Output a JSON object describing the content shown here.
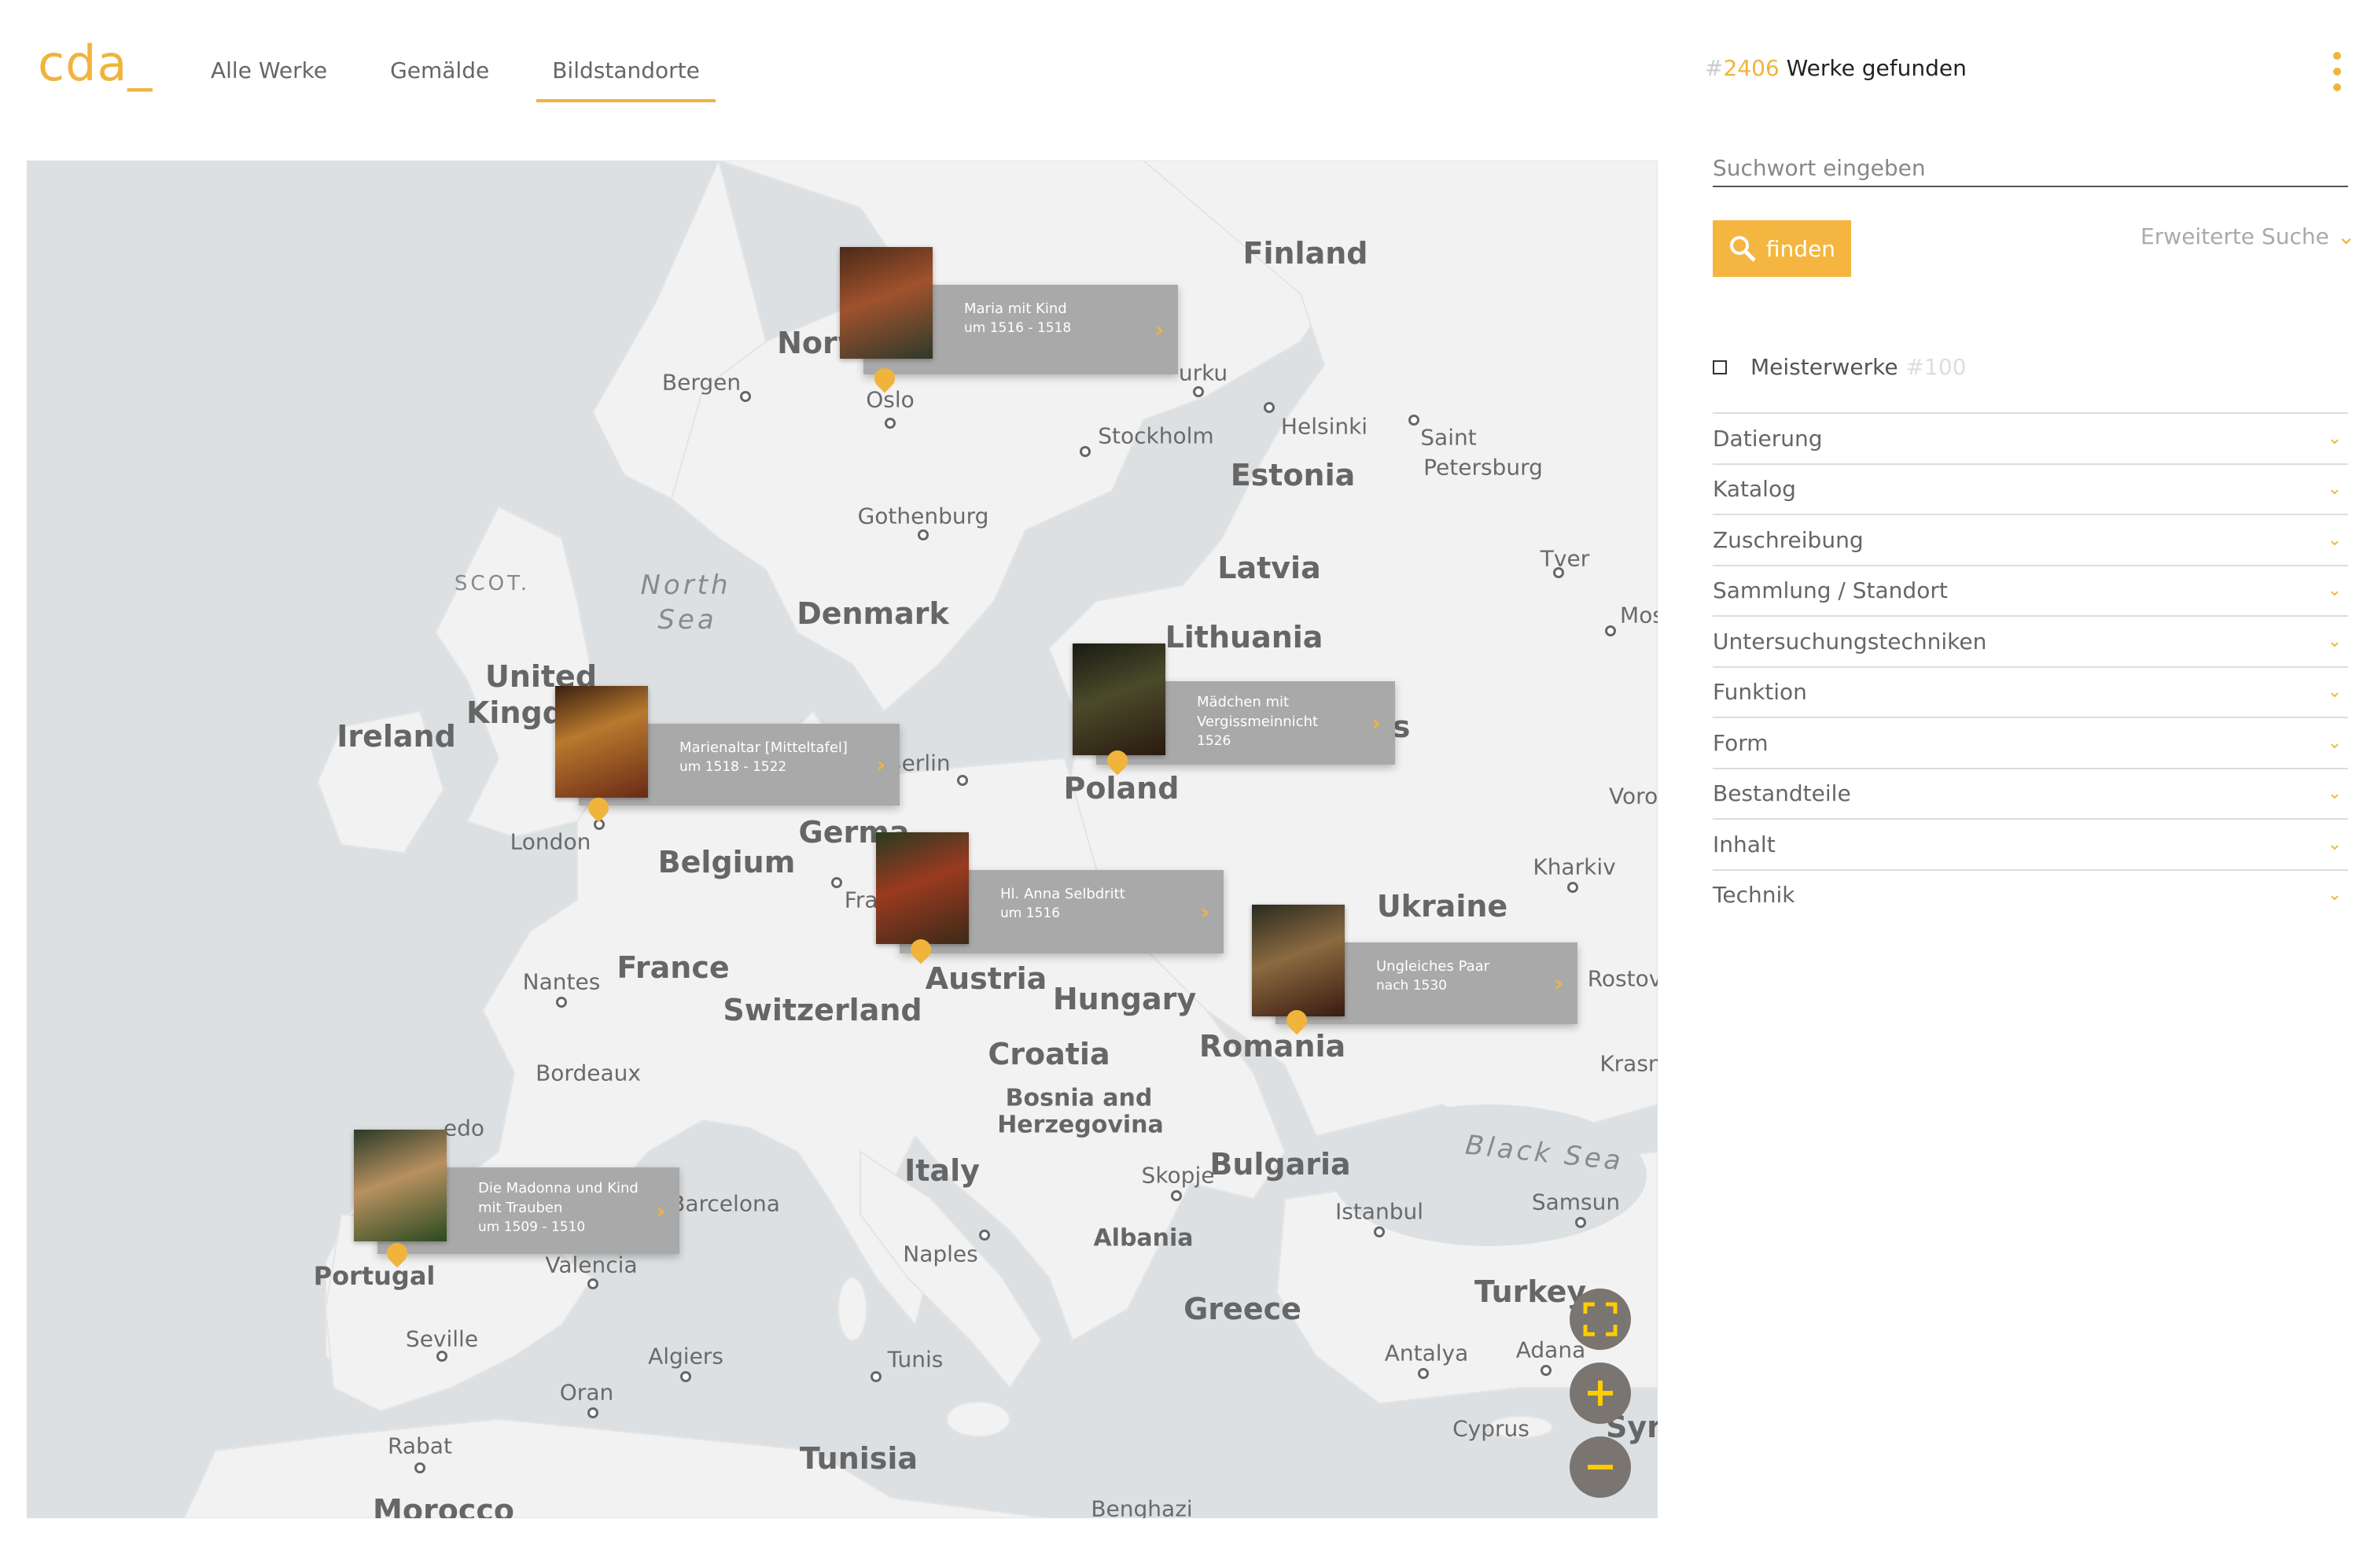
{
  "header": {
    "logo": "cda_",
    "nav": [
      "Alle Werke",
      "Gemälde",
      "Bildstandorte"
    ],
    "active_tab": "Bildstandorte",
    "result_hash": "#",
    "result_number": "2406",
    "result_text": " Werke gefunden"
  },
  "search": {
    "placeholder": "Suchwort eingeben",
    "find_label": "finden",
    "advanced_label": "Erweiterte Suche"
  },
  "masterworks": {
    "label": "Meisterwerke",
    "count": "#100"
  },
  "filters": [
    "Datierung",
    "Katalog",
    "Zuschreibung",
    "Sammlung / Standort",
    "Untersuchungstechniken",
    "Funktion",
    "Form",
    "Bestandteile",
    "Inhalt",
    "Technik"
  ],
  "map": {
    "countries": [
      "Finland",
      "Norw",
      "Estonia",
      "Latvia",
      "Denmark",
      "Lithuania",
      "United",
      "Kingdo",
      "Ireland",
      "Poland",
      "Germa",
      "Belgium",
      "France",
      "Austria",
      "Switzerland",
      "Hungary",
      "Ukraine",
      "Romania",
      "Croatia",
      "Bosnia and",
      "Herzegovina",
      "Italy",
      "Bulgaria",
      "Albania",
      "Greece",
      "Turkey",
      "Portugal",
      "Tunisia",
      "Morocco",
      "Syri",
      "s"
    ],
    "cities": [
      "Bergen",
      "Oslo",
      "urku",
      "Helsinki",
      "Saint",
      "Petersburg",
      "Stockholm",
      "Gothenburg",
      "Tver",
      "Mos",
      "Berlin",
      "London",
      "E",
      "Fran",
      "Voron",
      "Kharkiv",
      "Nantes",
      "Bordeaux",
      "Rostov",
      "Krasn",
      "edo",
      "Barcelona",
      "Valencia",
      "Seville",
      "Naples",
      "Skopje",
      "Istanbul",
      "Samsun",
      "Antalya",
      "Adana",
      "Cyprus",
      "Algiers",
      "Tunis",
      "Oran",
      "Rabat",
      "Benghazi"
    ],
    "seas": [
      "North",
      "Sea",
      "Black Sea",
      "SCOT."
    ],
    "popups": [
      {
        "title": "Maria mit Kind",
        "date": "um 1516 - 1518"
      },
      {
        "title": "Marienaltar [Mitteltafel]",
        "date": "um 1518 - 1522"
      },
      {
        "title": "Mädchen mit Vergissmeinnicht",
        "date": "1526"
      },
      {
        "title": "Hl. Anna Selbdritt",
        "date": "um 1516"
      },
      {
        "title": "Ungleiches Paar",
        "date": "nach 1530"
      },
      {
        "title": "Die Madonna und Kind mit Trauben",
        "date": "um 1509 - 1510"
      }
    ],
    "controls": [
      "fullscreen-icon",
      "zoom-in-icon",
      "zoom-out-icon"
    ]
  },
  "colors": {
    "accent": "#f0b43c",
    "map_water": "#dde0e2",
    "map_land": "#f2f2f2",
    "popup_bg": "#a9a9a9"
  }
}
